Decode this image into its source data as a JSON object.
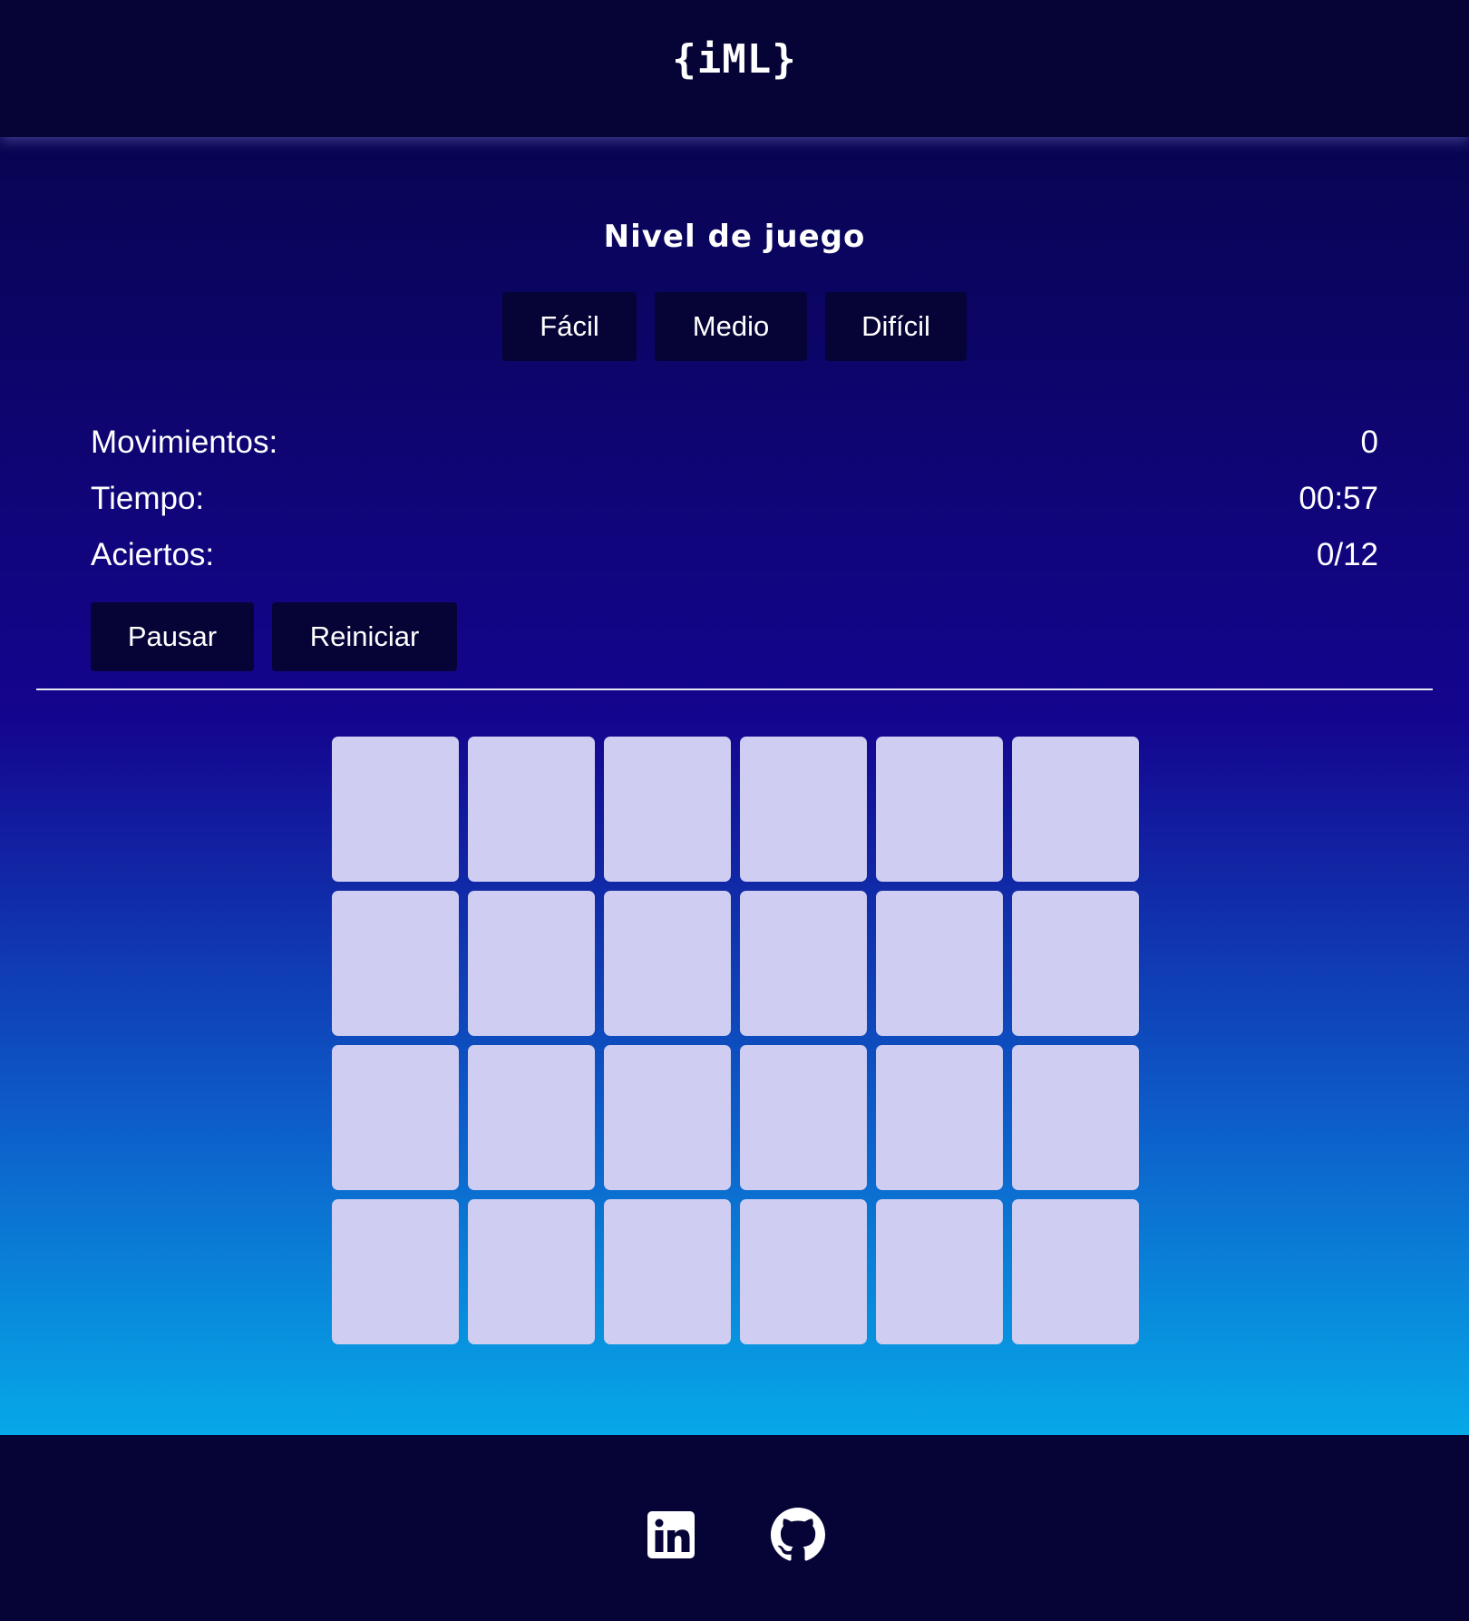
{
  "header": {
    "logo": "{iML}"
  },
  "level": {
    "title": "Nivel de juego",
    "buttons": [
      "Fácil",
      "Medio",
      "Difícil"
    ]
  },
  "stats": {
    "moves_label": "Movimientos:",
    "moves_value": "0",
    "time_label": "Tiempo:",
    "time_value": "00:57",
    "hits_label": "Aciertos:",
    "hits_value": "0/12"
  },
  "controls": {
    "pause_label": "Pausar",
    "restart_label": "Reiniciar"
  },
  "board": {
    "rows": 4,
    "columns": 6,
    "cards_face_down": 24
  },
  "footer": {
    "icons": [
      "linkedin-icon",
      "github-icon"
    ]
  },
  "colors": {
    "background_dark": "#060336",
    "card_back": "#cfcef2",
    "gradient_top": "#080552",
    "gradient_mid": "#14058f",
    "gradient_bottom": "#06a9e8"
  }
}
